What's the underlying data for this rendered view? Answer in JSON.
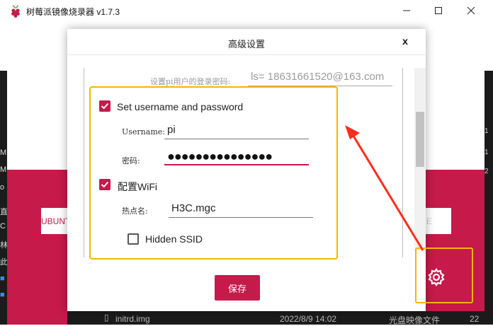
{
  "window": {
    "title": "树莓派镜像烧录器 v1.7.3"
  },
  "dialog": {
    "title": "高级设置",
    "close_label": "x",
    "pi_password_label": "设置pi用户的登录密码:",
    "pi_password_value": "ls= 18631661520@163.com",
    "set_user": {
      "label": "Set username and password",
      "checked": true
    },
    "username": {
      "label": "Username:",
      "value": "pi"
    },
    "password": {
      "label": "密码:",
      "value": "●●●●●●●●●●●●●●●"
    },
    "wifi": {
      "label": "配置WiFi",
      "checked": true
    },
    "ssid": {
      "label": "热点名:",
      "value": "H3C.mgc"
    },
    "hidden_ssid": {
      "label": "Hidden SSID",
      "checked": false
    },
    "save_label": "保存"
  },
  "background": {
    "os_button_label": "UBUNT",
    "file_name": "initrd.img",
    "file_date": "2022/8/9 14:02",
    "file_type": "光盘映像文件",
    "file_size": "22",
    "left_chars": [
      "M",
      "M",
      "o",
      "直",
      "C",
      "林",
      "此",
      "■",
      "■"
    ],
    "right_chars": [
      "1",
      "1",
      "2"
    ]
  },
  "colors": {
    "accent": "#c51a4a",
    "highlight": "#f7b500",
    "arrow": "#ff2d1a"
  }
}
